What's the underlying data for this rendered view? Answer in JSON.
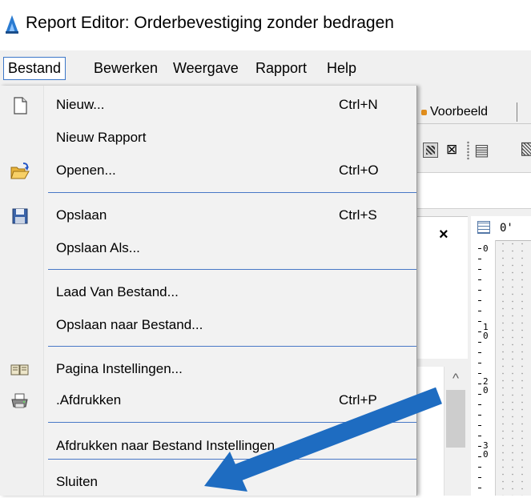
{
  "window": {
    "title": "Report Editor: Orderbevestiging zonder bedragen",
    "icon": "report-editor-app-icon"
  },
  "menubar": {
    "items": [
      {
        "label": "Bestand",
        "active": true
      },
      {
        "label": "Bewerken"
      },
      {
        "label": "Weergave"
      },
      {
        "label": "Rapport"
      },
      {
        "label": "Help"
      }
    ]
  },
  "dropdown": {
    "items": [
      {
        "label": "Nieuw...",
        "shortcut": "Ctrl+N",
        "icon": "new-document-icon"
      },
      {
        "label": "Nieuw Rapport",
        "shortcut": "",
        "icon": ""
      },
      {
        "label": "Openen...",
        "shortcut": "Ctrl+O",
        "icon": "open-folder-icon"
      },
      {
        "label": "Opslaan",
        "shortcut": "Ctrl+S",
        "icon": "floppy-save-icon"
      },
      {
        "label": "Opslaan Als...",
        "shortcut": "",
        "icon": ""
      },
      {
        "label": "Laad Van Bestand...",
        "shortcut": "",
        "icon": ""
      },
      {
        "label": "Opslaan naar Bestand...",
        "shortcut": "",
        "icon": ""
      },
      {
        "label": "Pagina Instellingen...",
        "shortcut": "",
        "icon": "page-setup-icon"
      },
      {
        "label": ".Afdrukken",
        "shortcut": "Ctrl+P",
        "icon": "printer-icon"
      },
      {
        "label": "Afdrukken naar Bestand Instellingen...",
        "shortcut": "",
        "icon": ""
      },
      {
        "label": "Sluiten",
        "shortcut": "",
        "icon": ""
      }
    ]
  },
  "background": {
    "tab_label": "Voorbeeld",
    "close_glyph": "×",
    "ruler_top_label": "0'",
    "ruler_left_labels": [
      "0",
      "1\n0",
      "2\n0",
      "3\n0"
    ]
  },
  "annotation": {
    "arrow_color": "#1e6cc1",
    "arrow_points_to": "Sluiten"
  },
  "colors": {
    "menu_highlight_border": "#3c77c8",
    "separator": "#4878c6",
    "menu_background": "#f2f2f2"
  }
}
